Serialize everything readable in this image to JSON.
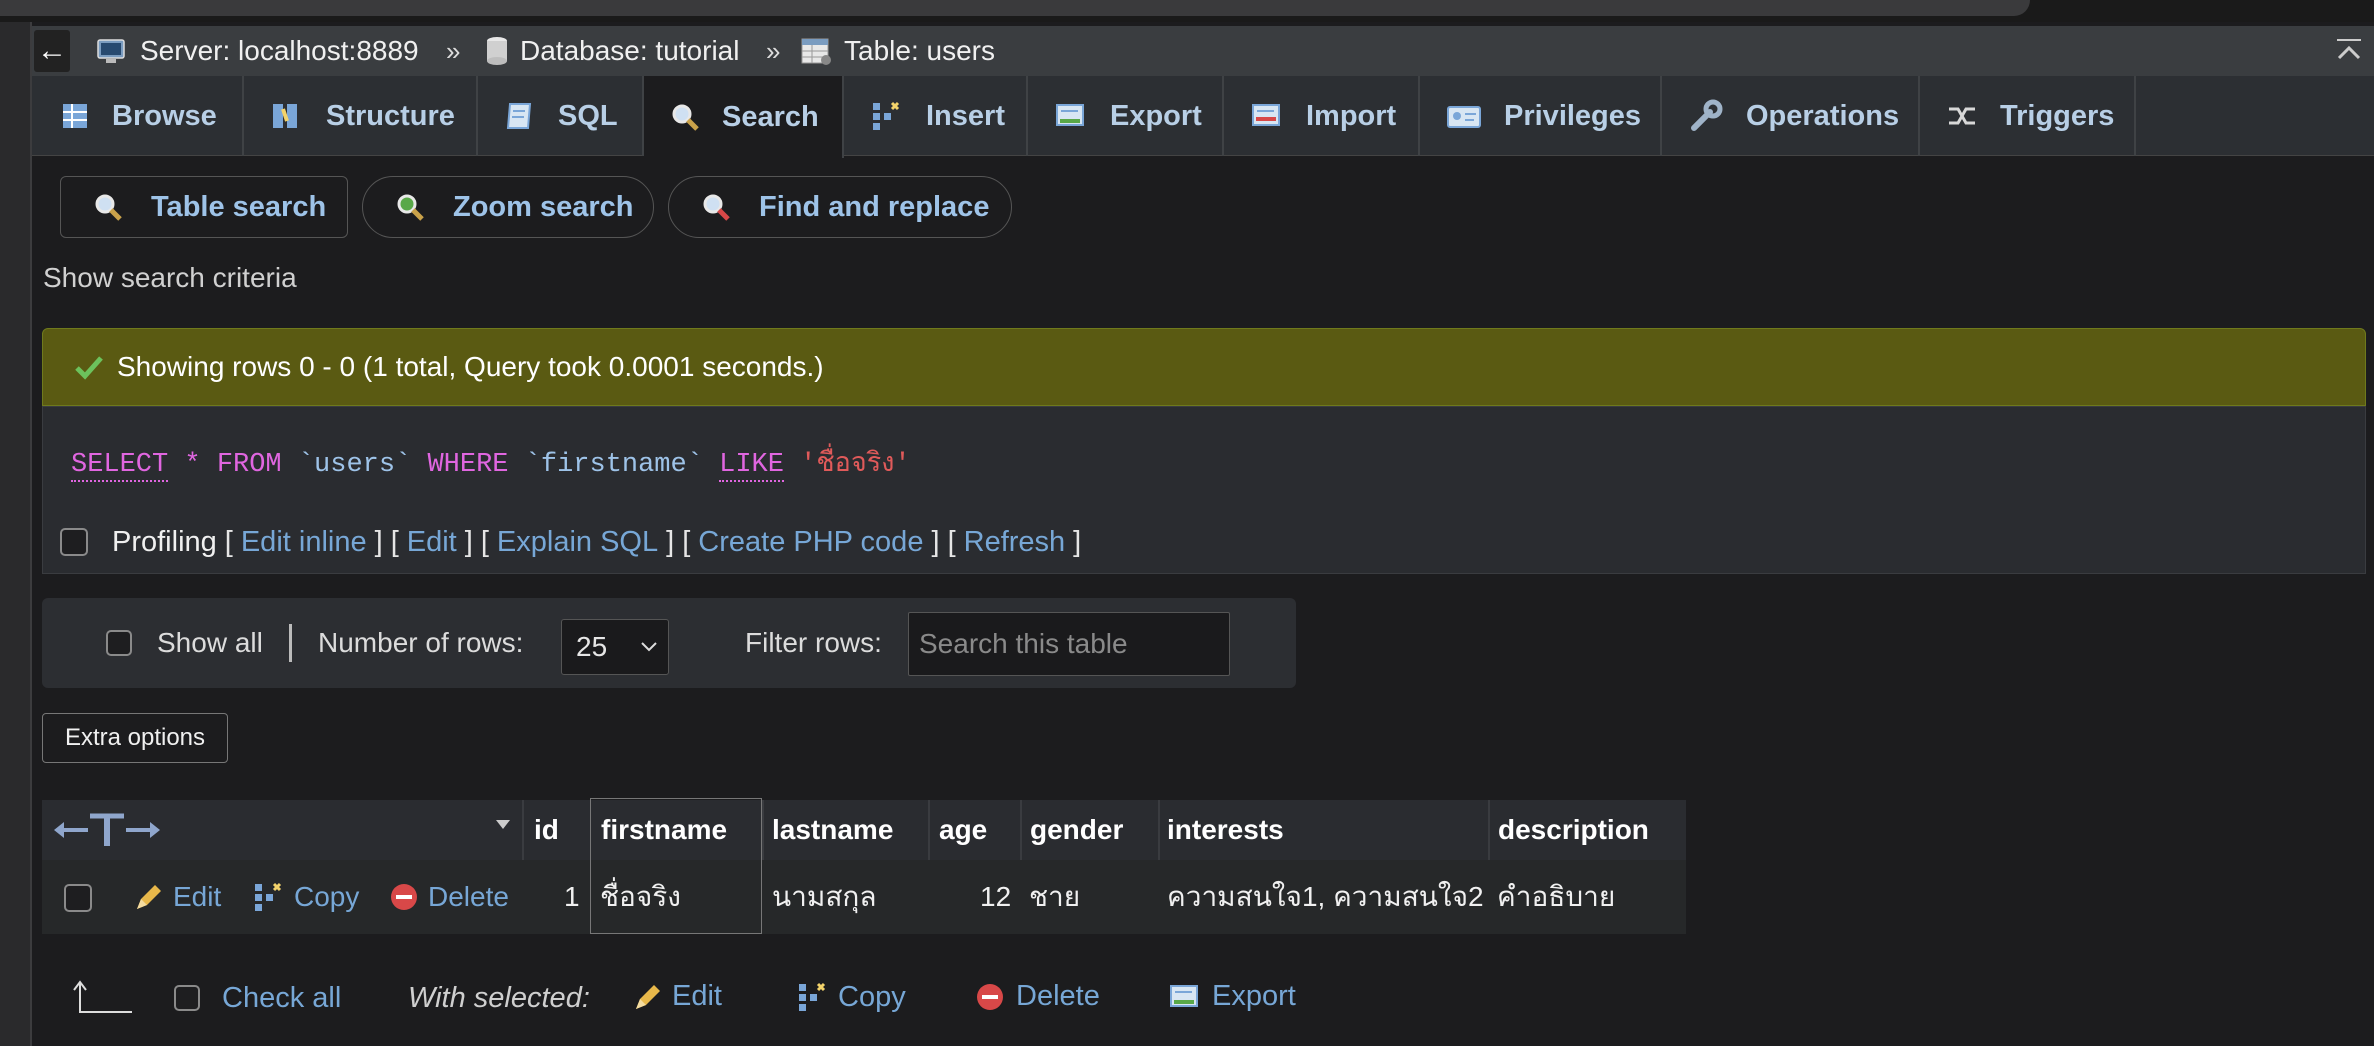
{
  "breadcrumb": {
    "server": "Server: localhost:8889",
    "database": "Database: tutorial",
    "table": "Table: users",
    "separator": "»"
  },
  "tabs": [
    {
      "label": "Browse",
      "icon": "browse-icon"
    },
    {
      "label": "Structure",
      "icon": "structure-icon"
    },
    {
      "label": "SQL",
      "icon": "sql-icon"
    },
    {
      "label": "Search",
      "icon": "search-icon",
      "active": true
    },
    {
      "label": "Insert",
      "icon": "insert-icon"
    },
    {
      "label": "Export",
      "icon": "export-icon"
    },
    {
      "label": "Import",
      "icon": "import-icon"
    },
    {
      "label": "Privileges",
      "icon": "privileges-icon"
    },
    {
      "label": "Operations",
      "icon": "wrench-icon"
    },
    {
      "label": "Triggers",
      "icon": "triggers-icon"
    }
  ],
  "subtabs": [
    {
      "label": "Table search",
      "active": true
    },
    {
      "label": "Zoom search"
    },
    {
      "label": "Find and replace"
    }
  ],
  "show_criteria": "Show search criteria",
  "success_message": "Showing rows 0 - 0 (1 total, Query took 0.0001 seconds.)",
  "sql": {
    "select": "SELECT",
    "star": "*",
    "from": "FROM",
    "table": "`users`",
    "where": "WHERE",
    "column": "`firstname`",
    "like": "LIKE",
    "value": "'ชื่อจริง'"
  },
  "profiling": {
    "label": "Profiling",
    "links": [
      "Edit inline",
      "Edit",
      "Explain SQL",
      "Create PHP code",
      "Refresh"
    ]
  },
  "navigation": {
    "show_all": "Show all",
    "rows_label": "Number of rows:",
    "rows_value": "25",
    "filter_label": "Filter rows:",
    "filter_placeholder": "Search this table"
  },
  "extra_options": "Extra options",
  "columns": [
    "id",
    "firstname",
    "lastname",
    "age",
    "gender",
    "interests",
    "description"
  ],
  "row": {
    "actions": [
      "Edit",
      "Copy",
      "Delete"
    ],
    "id": "1",
    "firstname": "ชื่อจริง",
    "lastname": "นามสกุล",
    "age": "12",
    "gender": "ชาย",
    "interests": "ความสนใจ1, ความสนใจ2",
    "description": "คำอธิบาย"
  },
  "bulk": {
    "check_all": "Check all",
    "with_selected": "With selected:",
    "actions": [
      "Edit",
      "Copy",
      "Delete",
      "Export"
    ]
  },
  "colors": {
    "link": "#77a7d6",
    "success_bg": "#5a5a12",
    "keyword": "#e066e0",
    "string": "#e05a5a"
  }
}
